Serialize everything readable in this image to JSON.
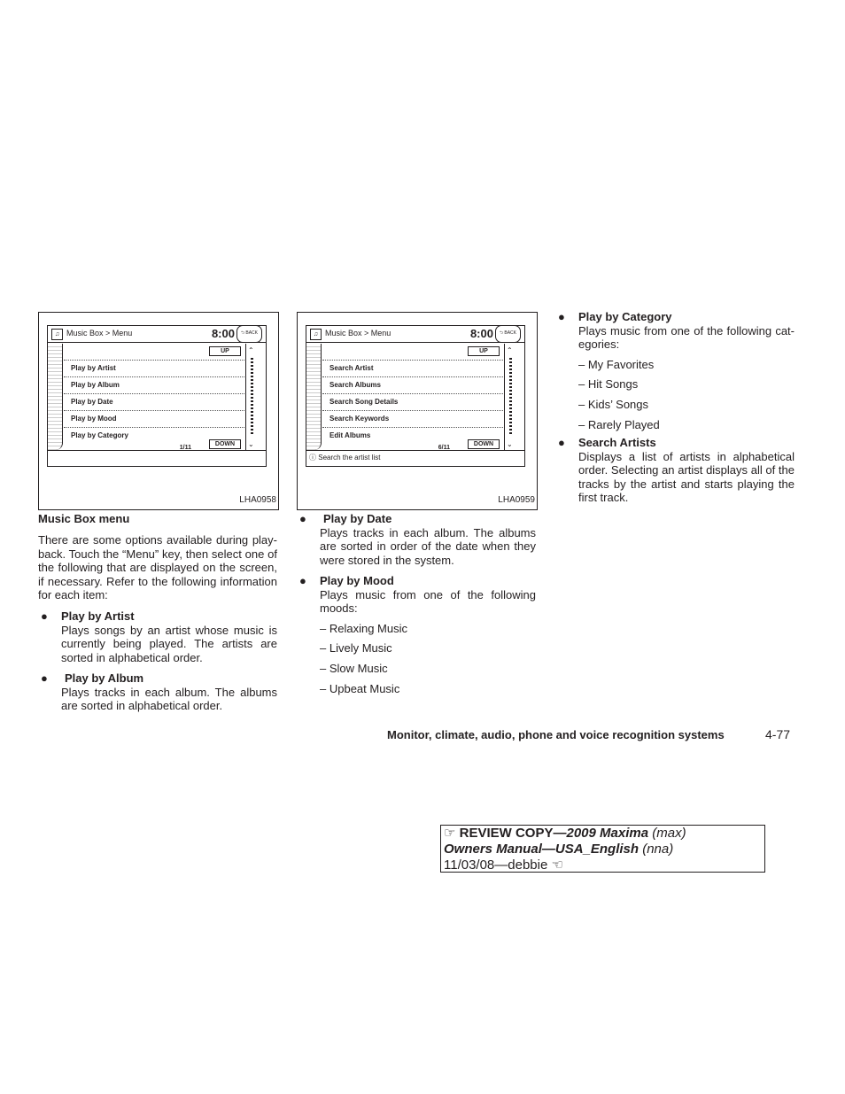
{
  "figures": [
    {
      "breadcrumb": "Music Box > Menu",
      "time": "8:00",
      "back": "BACK",
      "up": "UP",
      "down": "DOWN",
      "page": "1/11",
      "items": [
        "Play by Artist",
        "Play by Album",
        "Play by Date",
        "Play by Mood",
        "Play by Category"
      ],
      "status": "",
      "code": "LHA0958"
    },
    {
      "breadcrumb": "Music Box > Menu",
      "time": "8:00",
      "back": "BACK",
      "up": "UP",
      "down": "DOWN",
      "page": "6/11",
      "items": [
        "Search Artist",
        "Search Albums",
        "Search Song Details",
        "Search Keywords",
        "Edit Albums"
      ],
      "status": "Search the artist list",
      "code": "LHA0959"
    }
  ],
  "section_title": "Music Box menu",
  "intro": "There are some options available during play-back. Touch the “Menu” key, then select one of the following that are displayed on the screen, if necessary. Refer to the following information for each item:",
  "items": [
    {
      "title": "Play by Artist",
      "text": "Plays songs by an artist whose music is currently being played. The artists are sorted in alphabetical order."
    },
    {
      "title": "Play by Album",
      "text": "Plays tracks in each album. The albums are sorted in alphabetical order."
    },
    {
      "title": "Play by Date",
      "text": "Plays tracks in each album. The albums are sorted in order of the date when they were stored in the system."
    },
    {
      "title": "Play by Mood",
      "text": "Plays music from one of the following moods:",
      "list": [
        "–  Relaxing Music",
        "–  Lively Music",
        "–  Slow Music",
        "–  Upbeat Music"
      ]
    },
    {
      "title": "Play by Category",
      "text": "Plays music from one of the following cat-egories:",
      "list": [
        "–  My Favorites",
        "–  Hit Songs",
        "–  Kids’ Songs",
        "–  Rarely Played"
      ]
    },
    {
      "title": "Search Artists",
      "text": "Displays a list of artists in alphabetical order. Selecting an artist displays all of the tracks by the artist and starts playing the first track."
    }
  ],
  "footer": {
    "section": "Monitor, climate, audio, phone and voice recognition systems",
    "page": "4-77"
  },
  "stamp": {
    "line1a": "REVIEW COPY—",
    "line1b": "2009 Maxima",
    "line1c": " (max)",
    "line2a": "Owners Manual—USA_English",
    "line2b": " (nna)",
    "line3": "11/03/08—debbie"
  }
}
